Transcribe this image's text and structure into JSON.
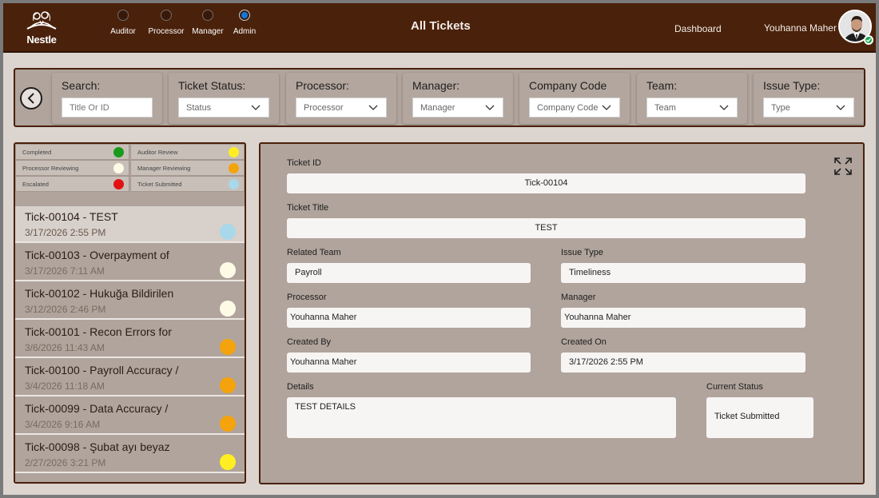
{
  "header": {
    "logo_text": "Nestle",
    "title": "All Tickets",
    "dashboard_label": "Dashboard",
    "user_name": "Youhanna Maher",
    "roles": [
      {
        "label": "Auditor",
        "selected": false
      },
      {
        "label": "Processor",
        "selected": false
      },
      {
        "label": "Manager",
        "selected": false
      },
      {
        "label": "Admin",
        "selected": true
      }
    ]
  },
  "filters": {
    "search": {
      "label": "Search:",
      "placeholder": "Title Or ID"
    },
    "status": {
      "label": "Ticket Status:",
      "value": "Status"
    },
    "processor": {
      "label": "Processor:",
      "value": "Processor"
    },
    "manager": {
      "label": "Manager:",
      "value": "Manager"
    },
    "company": {
      "label": "Company Code",
      "value": "Company Code"
    },
    "team": {
      "label": "Team:",
      "value": "Team"
    },
    "issue": {
      "label": "Issue Type:",
      "value": "Type"
    }
  },
  "legend": [
    {
      "label": "Completed",
      "color": "#1a9a1a"
    },
    {
      "label": "Auditor Review",
      "color": "#ffee22"
    },
    {
      "label": "Processor Reviewing",
      "color": "#fdfbe6"
    },
    {
      "label": "Manager Reviewing",
      "color": "#f5a30c"
    },
    {
      "label": "Escalated",
      "color": "#e31212"
    },
    {
      "label": "Ticket Submitted",
      "color": "#a8d8ea"
    }
  ],
  "tickets": [
    {
      "title": "Tick-00104 - TEST",
      "date": "3/17/2026 2:55 PM",
      "color": "#a8d8ea"
    },
    {
      "title": "Tick-00103 - Overpayment of",
      "date": "3/17/2026 7:11 AM",
      "color": "#fdfbe6"
    },
    {
      "title": "Tick-00102 - Hukuğa Bildirilen",
      "date": "3/12/2026 2:46 PM",
      "color": "#fdfbe6"
    },
    {
      "title": "Tick-00101 - Recon Errors for",
      "date": "3/6/2026 11:43 AM",
      "color": "#f5a30c"
    },
    {
      "title": "Tick-00100 - Payroll Accuracy /",
      "date": "3/4/2026 11:18 AM",
      "color": "#f5a30c"
    },
    {
      "title": "Tick-00099 - Data Accuracy /",
      "date": "3/4/2026 9:16 AM",
      "color": "#f5a30c"
    },
    {
      "title": "Tick-00098 - Şubat ayı beyaz",
      "date": "2/27/2026 3:21 PM",
      "color": "#ffee22"
    }
  ],
  "detail": {
    "ticket_id_label": "Ticket ID",
    "ticket_id": "Tick-00104",
    "ticket_title_label": "Ticket Title",
    "ticket_title": "TEST",
    "team_label": "Related Team",
    "team": "Payroll",
    "issue_label": "Issue Type",
    "issue": "Timeliness",
    "processor_label": "Processor",
    "processor": "Youhanna Maher",
    "manager_label": "Manager",
    "manager": "Youhanna Maher",
    "created_by_label": "Created By",
    "created_by": "Youhanna Maher",
    "created_on_label": "Created On",
    "created_on": "3/17/2026 2:55 PM",
    "details_label": "Details",
    "details": "TEST DETAILS",
    "status_label": "Current Status",
    "status": "Ticket Submitted"
  },
  "icons": {
    "back": "back-arrow-icon",
    "expand": "expand-icon",
    "chevron": "chevron-down-icon"
  }
}
